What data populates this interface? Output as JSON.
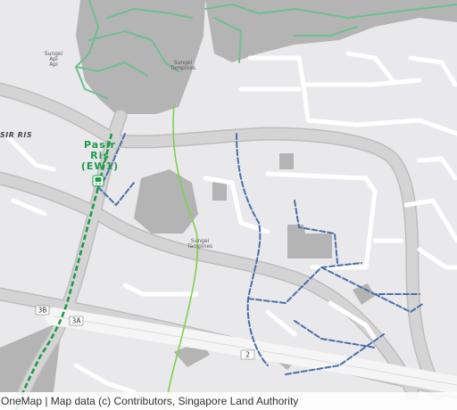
{
  "map": {
    "labels": {
      "sungei_api_api": [
        "Sungei",
        "Api",
        "Api"
      ],
      "sungei_tampines_north": [
        "Sungei",
        "Tampines"
      ],
      "sungei_tampines_south": [
        "Sungei",
        "Tampines"
      ],
      "area_pasir_ris": "SIR RIS"
    },
    "station": {
      "name_line1": "Pasir",
      "name_line2": "Ris",
      "code": "(EW1)",
      "line_color": "#1e9a4c",
      "icon": "train-icon"
    },
    "road_shields": {
      "exit_3b": "3B",
      "exit_3a": "3A",
      "expressway": "2"
    },
    "colors": {
      "land": "#e9e9eb",
      "road": "#d4d4d4",
      "road_edge": "#bdbdbd",
      "minor_road": "#ffffff",
      "building": "#b4b4b4",
      "water_path": "#6fbf8f",
      "cycle_path": "#4b6fa8",
      "rail": "#1e9a4c"
    }
  },
  "attribution": "OneMap | Map data (c) Contributors, Singapore Land Authority"
}
